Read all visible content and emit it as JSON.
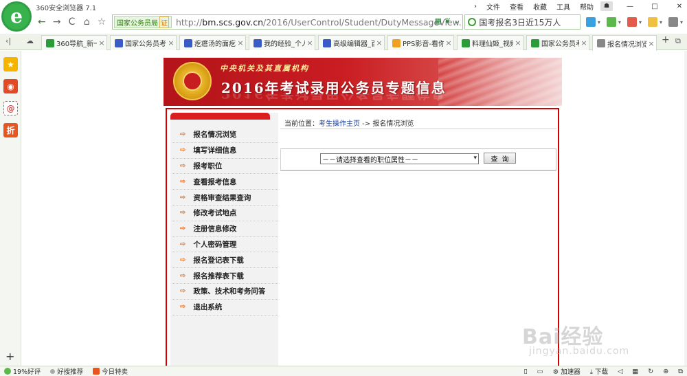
{
  "browser": {
    "title": "360安全浏览器 7.1",
    "logo_glyph": "e",
    "menu": [
      "文件",
      "查看",
      "收藏",
      "工具",
      "帮助"
    ],
    "window_buttons": [
      "—",
      "□",
      "✕"
    ],
    "skin_glyph": "☗"
  },
  "address_bar": {
    "site_badge": "国家公务员局",
    "cert_label": "证",
    "url_prefix": "http://",
    "url_domain": "bm.scs.gov.cn",
    "url_path": "/2016/UserControl/Student/DutyMessageView.",
    "search_text": "国考报名3日近15万人"
  },
  "nav": {
    "back_glyph": "←",
    "forward_glyph": "→",
    "refresh_glyph": "C",
    "home_glyph": "⌂",
    "favorite_glyph": "☆"
  },
  "tabs": [
    {
      "label": "360导航_新一",
      "color": "#2a9d3a"
    },
    {
      "label": "国家公务员考",
      "color": "#3a5bc7"
    },
    {
      "label": "疙瘩汤的面疙",
      "color": "#3a5bc7"
    },
    {
      "label": "我的经验_个人",
      "color": "#3a5bc7"
    },
    {
      "label": "高级编辑器_百",
      "color": "#3a5bc7"
    },
    {
      "label": "PPS影音-看你",
      "color": "#f0a020"
    },
    {
      "label": "料理仙姬_视频",
      "color": "#2a9d3a"
    },
    {
      "label": "国家公务员考",
      "color": "#2a9d3a"
    },
    {
      "label": "报名情况浏览",
      "color": "#888888"
    }
  ],
  "tab_close": "×",
  "sidebar_icons": [
    {
      "name": "favorites-star-icon",
      "glyph": "★",
      "color": "#f5b400"
    },
    {
      "name": "weibo-icon",
      "glyph": "◉",
      "color": "#e24a25"
    },
    {
      "name": "email-icon",
      "glyph": "@",
      "color": "#e04a4a"
    },
    {
      "name": "discount-icon",
      "glyph": "折",
      "color": "#e8551e"
    }
  ],
  "sidebar_add": "+",
  "banner": {
    "subtitle": "中央机关及其直属机构",
    "title": "2016年考试录用公务员专题信息"
  },
  "menu": {
    "arrow": "⇨",
    "items": [
      "报名情况浏览",
      "填写详细信息",
      "报考职位",
      "查看报考信息",
      "资格审查结果查询",
      "修改考试地点",
      "注册信息修改",
      "个人密码管理",
      "报名登记表下载",
      "报名推荐表下载",
      "政策、技术和考务问答",
      "退出系统"
    ]
  },
  "breadcrumb": {
    "prefix": "当前位置：",
    "link": "考生操作主页",
    "separator": " -> ",
    "current": "报名情况浏览"
  },
  "form": {
    "select_value": "－－请选择查看的职位属性－－",
    "query_button": "查询"
  },
  "watermark": {
    "main": "Bai经验",
    "sub": "jingyan.baidu.com"
  },
  "statusbar": {
    "rating": "19%好评",
    "recommend": "好搜推荐",
    "deals": "今日特卖",
    "accelerator": "加速器",
    "download": "下载"
  },
  "colors": {
    "frame_red": "#d30000",
    "accent_green": "#37b24d",
    "link_blue": "#1a3fa0",
    "menu_arrow": "#e8670e"
  }
}
